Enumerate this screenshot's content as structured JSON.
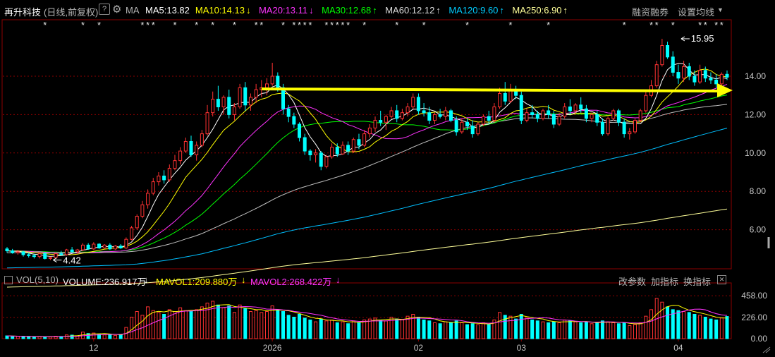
{
  "header": {
    "stock_name": "再升科技",
    "period_label": "(日线,前复权)",
    "help_icon": "question-icon",
    "settings_icon": "gear-icon",
    "ma_label": "MA",
    "ma_items": [
      {
        "text": "MA5:13.82",
        "arrow": "",
        "color": "#ffffff"
      },
      {
        "text": "MA10:14.13",
        "arrow": "↓",
        "color": "#ffff00"
      },
      {
        "text": "MA20:13.11",
        "arrow": "↓",
        "color": "#ff33ff"
      },
      {
        "text": "MA30:12.68",
        "arrow": "↑",
        "color": "#00ff00"
      },
      {
        "text": "MA60:12.12",
        "arrow": "↑",
        "color": "#dcdcdc"
      },
      {
        "text": "MA120:9.60",
        "arrow": "↑",
        "color": "#00ccff"
      },
      {
        "text": "MA250:6.90",
        "arrow": "↑",
        "color": "#ffff99"
      }
    ],
    "margin_btn": "融资融券",
    "ma_setting_btn": "设置均线"
  },
  "volume_header": {
    "label": "VOL(5,10)",
    "volume": "VOLUME:236.917万",
    "volume_arrow": "↓",
    "mavol1": "MAVOL1:209.880万",
    "mavol1_arrow": "↓",
    "mavol2": "MAVOL2:268.422万",
    "mavol2_arrow": "↓",
    "btn_params": "改参数",
    "btn_add": "加指标",
    "btn_switch": "换指标"
  },
  "colors": {
    "up": "#ff3232",
    "down": "#00ffff",
    "ma5": "#ffffff",
    "ma10": "#ffff00",
    "ma20": "#ff33ff",
    "ma30": "#00ff00",
    "ma60": "#c0c0c0",
    "ma120": "#00bfff",
    "ma250": "#ffff99",
    "trend_arrow": "#ffff00",
    "grid": "#8b0000",
    "axis_text": "#c8c8c8"
  },
  "chart_data": {
    "type": "candlestick",
    "price_axis": {
      "ticks": [
        "14.00",
        "12.00",
        "10.00",
        "8.00",
        "6.00"
      ],
      "values": [
        14,
        12,
        10,
        8,
        6
      ],
      "ylim": [
        4.0,
        16.5
      ]
    },
    "volume_axis": {
      "ticks": [
        "458.00",
        "226.00",
        "0.00"
      ],
      "values": [
        458,
        226,
        0
      ],
      "ylim": [
        0,
        520
      ]
    },
    "x_ticks": [
      {
        "label": "12",
        "index": 16
      },
      {
        "label": "2026",
        "index": 49
      },
      {
        "label": "02",
        "index": 76
      },
      {
        "label": "03",
        "index": 95
      },
      {
        "label": "04",
        "index": 124
      }
    ],
    "annotations": {
      "high": {
        "label": "15.95",
        "value": 15.95,
        "index": 124
      },
      "low": {
        "label": "4.42",
        "value": 4.42,
        "index": 8
      }
    },
    "trend_line": {
      "value": 13.3,
      "from_index": 47,
      "to_index": 137
    },
    "star_marker": "*",
    "star_indices": [
      7,
      14,
      17,
      25,
      26,
      27,
      31,
      35,
      38,
      42,
      46,
      47,
      51,
      53,
      54,
      55,
      56,
      59,
      60,
      61,
      62,
      63,
      66,
      72,
      77,
      85,
      93,
      100,
      114,
      119,
      120,
      123,
      128,
      129,
      131,
      132
    ],
    "candles": [
      {
        "o": 5.0,
        "h": 5.1,
        "l": 4.8,
        "c": 4.9,
        "v": 30
      },
      {
        "o": 4.9,
        "h": 5.0,
        "l": 4.75,
        "c": 4.8,
        "v": 26
      },
      {
        "o": 4.8,
        "h": 4.95,
        "l": 4.7,
        "c": 4.85,
        "v": 24
      },
      {
        "o": 4.85,
        "h": 4.9,
        "l": 4.6,
        "c": 4.7,
        "v": 22
      },
      {
        "o": 4.7,
        "h": 4.8,
        "l": 4.55,
        "c": 4.65,
        "v": 20
      },
      {
        "o": 4.65,
        "h": 4.75,
        "l": 4.5,
        "c": 4.6,
        "v": 18
      },
      {
        "o": 4.6,
        "h": 4.8,
        "l": 4.5,
        "c": 4.75,
        "v": 22
      },
      {
        "o": 4.75,
        "h": 4.85,
        "l": 4.45,
        "c": 4.5,
        "v": 20
      },
      {
        "o": 4.5,
        "h": 4.6,
        "l": 4.42,
        "c": 4.55,
        "v": 18
      },
      {
        "o": 4.55,
        "h": 4.8,
        "l": 4.5,
        "c": 4.75,
        "v": 26
      },
      {
        "o": 4.75,
        "h": 4.9,
        "l": 4.65,
        "c": 4.7,
        "v": 24
      },
      {
        "o": 4.7,
        "h": 5.0,
        "l": 4.65,
        "c": 4.95,
        "v": 40
      },
      {
        "o": 4.95,
        "h": 5.1,
        "l": 4.8,
        "c": 4.85,
        "v": 38
      },
      {
        "o": 4.85,
        "h": 5.0,
        "l": 4.75,
        "c": 4.95,
        "v": 30
      },
      {
        "o": 4.95,
        "h": 5.3,
        "l": 4.9,
        "c": 5.2,
        "v": 70
      },
      {
        "o": 5.2,
        "h": 5.3,
        "l": 4.95,
        "c": 5.0,
        "v": 55
      },
      {
        "o": 5.0,
        "h": 5.35,
        "l": 4.95,
        "c": 5.25,
        "v": 60
      },
      {
        "o": 5.25,
        "h": 5.3,
        "l": 5.0,
        "c": 5.05,
        "v": 45
      },
      {
        "o": 5.05,
        "h": 5.25,
        "l": 5.0,
        "c": 5.2,
        "v": 40
      },
      {
        "o": 5.2,
        "h": 5.3,
        "l": 4.95,
        "c": 5.0,
        "v": 48
      },
      {
        "o": 5.0,
        "h": 5.2,
        "l": 4.95,
        "c": 5.15,
        "v": 35
      },
      {
        "o": 5.15,
        "h": 5.25,
        "l": 5.0,
        "c": 5.05,
        "v": 40
      },
      {
        "o": 5.05,
        "h": 5.6,
        "l": 5.0,
        "c": 5.5,
        "v": 120
      },
      {
        "o": 5.5,
        "h": 6.2,
        "l": 5.45,
        "c": 6.1,
        "v": 230
      },
      {
        "o": 6.1,
        "h": 6.8,
        "l": 6.0,
        "c": 6.7,
        "v": 290
      },
      {
        "o": 6.7,
        "h": 7.5,
        "l": 6.6,
        "c": 7.3,
        "v": 250
      },
      {
        "o": 7.3,
        "h": 8.1,
        "l": 7.1,
        "c": 7.9,
        "v": 340
      },
      {
        "o": 7.9,
        "h": 8.7,
        "l": 7.8,
        "c": 8.5,
        "v": 300
      },
      {
        "o": 8.5,
        "h": 9.0,
        "l": 8.3,
        "c": 8.8,
        "v": 280
      },
      {
        "o": 8.8,
        "h": 9.1,
        "l": 8.4,
        "c": 8.6,
        "v": 260
      },
      {
        "o": 8.6,
        "h": 9.4,
        "l": 8.5,
        "c": 9.2,
        "v": 310
      },
      {
        "o": 9.2,
        "h": 9.9,
        "l": 9.1,
        "c": 9.6,
        "v": 290
      },
      {
        "o": 9.6,
        "h": 10.3,
        "l": 9.4,
        "c": 10.1,
        "v": 330
      },
      {
        "o": 10.1,
        "h": 10.8,
        "l": 10.0,
        "c": 10.6,
        "v": 300
      },
      {
        "o": 10.6,
        "h": 10.9,
        "l": 9.8,
        "c": 9.9,
        "v": 290
      },
      {
        "o": 9.9,
        "h": 10.6,
        "l": 9.6,
        "c": 10.4,
        "v": 310
      },
      {
        "o": 10.4,
        "h": 11.2,
        "l": 10.3,
        "c": 11.0,
        "v": 340
      },
      {
        "o": 11.0,
        "h": 12.5,
        "l": 10.9,
        "c": 12.1,
        "v": 380
      },
      {
        "o": 12.1,
        "h": 13.2,
        "l": 11.9,
        "c": 12.8,
        "v": 400
      },
      {
        "o": 12.8,
        "h": 13.5,
        "l": 12.2,
        "c": 12.4,
        "v": 360
      },
      {
        "o": 12.4,
        "h": 13.0,
        "l": 12.0,
        "c": 12.9,
        "v": 330
      },
      {
        "o": 12.9,
        "h": 13.3,
        "l": 11.8,
        "c": 12.0,
        "v": 350
      },
      {
        "o": 12.0,
        "h": 12.6,
        "l": 11.7,
        "c": 12.4,
        "v": 280
      },
      {
        "o": 12.4,
        "h": 13.6,
        "l": 12.3,
        "c": 13.4,
        "v": 360
      },
      {
        "o": 13.4,
        "h": 13.7,
        "l": 12.2,
        "c": 12.5,
        "v": 320
      },
      {
        "o": 12.5,
        "h": 13.1,
        "l": 12.2,
        "c": 12.9,
        "v": 290
      },
      {
        "o": 12.9,
        "h": 13.6,
        "l": 12.6,
        "c": 13.3,
        "v": 300
      },
      {
        "o": 13.3,
        "h": 13.8,
        "l": 12.9,
        "c": 13.4,
        "v": 280
      },
      {
        "o": 13.4,
        "h": 13.9,
        "l": 13.0,
        "c": 13.6,
        "v": 290
      },
      {
        "o": 13.6,
        "h": 14.7,
        "l": 13.5,
        "c": 14.0,
        "v": 350
      },
      {
        "o": 14.0,
        "h": 14.2,
        "l": 13.2,
        "c": 13.4,
        "v": 310
      },
      {
        "o": 13.4,
        "h": 13.6,
        "l": 12.0,
        "c": 12.3,
        "v": 290
      },
      {
        "o": 12.3,
        "h": 12.5,
        "l": 11.6,
        "c": 11.9,
        "v": 250
      },
      {
        "o": 11.9,
        "h": 12.1,
        "l": 11.3,
        "c": 11.5,
        "v": 230
      },
      {
        "o": 11.5,
        "h": 11.6,
        "l": 10.6,
        "c": 10.8,
        "v": 260
      },
      {
        "o": 10.8,
        "h": 11.0,
        "l": 9.9,
        "c": 10.1,
        "v": 220
      },
      {
        "o": 10.1,
        "h": 10.2,
        "l": 9.6,
        "c": 9.9,
        "v": 200
      },
      {
        "o": 9.9,
        "h": 10.2,
        "l": 9.5,
        "c": 10.0,
        "v": 180
      },
      {
        "o": 10.0,
        "h": 10.1,
        "l": 9.1,
        "c": 9.3,
        "v": 210
      },
      {
        "o": 9.3,
        "h": 9.9,
        "l": 9.2,
        "c": 9.8,
        "v": 190
      },
      {
        "o": 9.8,
        "h": 10.5,
        "l": 9.7,
        "c": 10.3,
        "v": 200
      },
      {
        "o": 10.3,
        "h": 10.5,
        "l": 9.8,
        "c": 9.95,
        "v": 170
      },
      {
        "o": 9.95,
        "h": 10.6,
        "l": 9.9,
        "c": 10.4,
        "v": 180
      },
      {
        "o": 10.4,
        "h": 10.6,
        "l": 9.9,
        "c": 10.1,
        "v": 160
      },
      {
        "o": 10.1,
        "h": 10.8,
        "l": 10.0,
        "c": 10.7,
        "v": 190
      },
      {
        "o": 10.7,
        "h": 11.0,
        "l": 10.2,
        "c": 10.4,
        "v": 170
      },
      {
        "o": 10.4,
        "h": 11.2,
        "l": 10.3,
        "c": 11.0,
        "v": 200
      },
      {
        "o": 11.0,
        "h": 11.5,
        "l": 10.8,
        "c": 11.3,
        "v": 210
      },
      {
        "o": 11.3,
        "h": 11.9,
        "l": 11.1,
        "c": 11.7,
        "v": 220
      },
      {
        "o": 11.7,
        "h": 12.2,
        "l": 11.4,
        "c": 11.6,
        "v": 200
      },
      {
        "o": 11.6,
        "h": 12.0,
        "l": 11.2,
        "c": 11.9,
        "v": 190
      },
      {
        "o": 11.9,
        "h": 12.4,
        "l": 11.8,
        "c": 12.2,
        "v": 230
      },
      {
        "o": 12.2,
        "h": 12.5,
        "l": 11.6,
        "c": 11.8,
        "v": 210
      },
      {
        "o": 11.8,
        "h": 12.3,
        "l": 11.7,
        "c": 12.1,
        "v": 200
      },
      {
        "o": 12.1,
        "h": 12.6,
        "l": 11.9,
        "c": 12.4,
        "v": 240
      },
      {
        "o": 12.4,
        "h": 13.1,
        "l": 12.3,
        "c": 12.9,
        "v": 260
      },
      {
        "o": 12.9,
        "h": 13.1,
        "l": 12.0,
        "c": 12.2,
        "v": 230
      },
      {
        "o": 12.2,
        "h": 12.6,
        "l": 11.9,
        "c": 12.1,
        "v": 200
      },
      {
        "o": 12.1,
        "h": 12.4,
        "l": 11.5,
        "c": 11.7,
        "v": 190
      },
      {
        "o": 11.7,
        "h": 12.1,
        "l": 11.5,
        "c": 12.0,
        "v": 170
      },
      {
        "o": 12.0,
        "h": 12.3,
        "l": 11.8,
        "c": 11.9,
        "v": 160
      },
      {
        "o": 11.9,
        "h": 12.4,
        "l": 11.7,
        "c": 12.2,
        "v": 180
      },
      {
        "o": 12.2,
        "h": 12.3,
        "l": 11.6,
        "c": 11.7,
        "v": 170
      },
      {
        "o": 11.7,
        "h": 11.9,
        "l": 10.9,
        "c": 11.1,
        "v": 190
      },
      {
        "o": 11.1,
        "h": 11.8,
        "l": 11.0,
        "c": 11.6,
        "v": 170
      },
      {
        "o": 11.6,
        "h": 11.8,
        "l": 11.2,
        "c": 11.4,
        "v": 150
      },
      {
        "o": 11.4,
        "h": 11.7,
        "l": 10.8,
        "c": 11.0,
        "v": 160
      },
      {
        "o": 11.0,
        "h": 11.6,
        "l": 10.9,
        "c": 11.5,
        "v": 150
      },
      {
        "o": 11.5,
        "h": 12.0,
        "l": 11.4,
        "c": 11.9,
        "v": 170
      },
      {
        "o": 11.9,
        "h": 12.2,
        "l": 11.5,
        "c": 11.7,
        "v": 150
      },
      {
        "o": 11.7,
        "h": 12.6,
        "l": 11.6,
        "c": 12.4,
        "v": 200
      },
      {
        "o": 12.4,
        "h": 13.4,
        "l": 12.3,
        "c": 13.1,
        "v": 280
      },
      {
        "o": 13.1,
        "h": 13.7,
        "l": 12.5,
        "c": 12.7,
        "v": 250
      },
      {
        "o": 12.7,
        "h": 13.6,
        "l": 12.6,
        "c": 13.3,
        "v": 240
      },
      {
        "o": 13.3,
        "h": 13.5,
        "l": 12.8,
        "c": 13.0,
        "v": 210
      },
      {
        "o": 13.0,
        "h": 13.2,
        "l": 11.5,
        "c": 11.7,
        "v": 260
      },
      {
        "o": 11.7,
        "h": 12.3,
        "l": 11.6,
        "c": 12.1,
        "v": 220
      },
      {
        "o": 12.1,
        "h": 12.5,
        "l": 11.8,
        "c": 12.0,
        "v": 200
      },
      {
        "o": 12.0,
        "h": 12.2,
        "l": 11.6,
        "c": 11.8,
        "v": 190
      },
      {
        "o": 11.8,
        "h": 12.3,
        "l": 11.7,
        "c": 12.2,
        "v": 180
      },
      {
        "o": 12.2,
        "h": 12.5,
        "l": 11.8,
        "c": 12.0,
        "v": 170
      },
      {
        "o": 12.0,
        "h": 12.2,
        "l": 11.3,
        "c": 11.5,
        "v": 180
      },
      {
        "o": 11.5,
        "h": 12.1,
        "l": 11.4,
        "c": 11.9,
        "v": 170
      },
      {
        "o": 11.9,
        "h": 12.6,
        "l": 11.8,
        "c": 12.4,
        "v": 200
      },
      {
        "o": 12.4,
        "h": 12.8,
        "l": 12.0,
        "c": 12.2,
        "v": 190
      },
      {
        "o": 12.2,
        "h": 12.6,
        "l": 12.0,
        "c": 12.5,
        "v": 180
      },
      {
        "o": 12.5,
        "h": 12.9,
        "l": 12.1,
        "c": 12.3,
        "v": 170
      },
      {
        "o": 12.3,
        "h": 12.5,
        "l": 11.6,
        "c": 11.8,
        "v": 180
      },
      {
        "o": 11.8,
        "h": 12.1,
        "l": 11.6,
        "c": 12.0,
        "v": 160
      },
      {
        "o": 12.0,
        "h": 12.2,
        "l": 11.4,
        "c": 11.6,
        "v": 170
      },
      {
        "o": 11.6,
        "h": 11.8,
        "l": 10.9,
        "c": 11.0,
        "v": 190
      },
      {
        "o": 11.0,
        "h": 11.9,
        "l": 10.9,
        "c": 11.8,
        "v": 180
      },
      {
        "o": 11.8,
        "h": 12.3,
        "l": 11.7,
        "c": 12.2,
        "v": 170
      },
      {
        "o": 12.2,
        "h": 12.3,
        "l": 11.4,
        "c": 11.6,
        "v": 160
      },
      {
        "o": 11.6,
        "h": 11.8,
        "l": 10.8,
        "c": 11.0,
        "v": 170
      },
      {
        "o": 11.0,
        "h": 11.3,
        "l": 10.7,
        "c": 11.1,
        "v": 140
      },
      {
        "o": 11.1,
        "h": 11.8,
        "l": 11.0,
        "c": 11.7,
        "v": 150
      },
      {
        "o": 11.7,
        "h": 12.3,
        "l": 11.6,
        "c": 12.2,
        "v": 170
      },
      {
        "o": 12.2,
        "h": 13.2,
        "l": 12.1,
        "c": 13.0,
        "v": 240
      },
      {
        "o": 13.0,
        "h": 13.8,
        "l": 12.9,
        "c": 13.5,
        "v": 310
      },
      {
        "o": 13.5,
        "h": 14.8,
        "l": 13.4,
        "c": 14.6,
        "v": 430
      },
      {
        "o": 14.6,
        "h": 15.95,
        "l": 14.5,
        "c": 15.6,
        "v": 390
      },
      {
        "o": 15.6,
        "h": 15.8,
        "l": 14.9,
        "c": 15.0,
        "v": 340
      },
      {
        "o": 15.0,
        "h": 15.3,
        "l": 14.0,
        "c": 14.2,
        "v": 310
      },
      {
        "o": 14.2,
        "h": 14.6,
        "l": 13.6,
        "c": 13.9,
        "v": 300
      },
      {
        "o": 13.9,
        "h": 14.8,
        "l": 13.7,
        "c": 14.5,
        "v": 290
      },
      {
        "o": 14.5,
        "h": 14.7,
        "l": 13.8,
        "c": 14.0,
        "v": 280
      },
      {
        "o": 14.0,
        "h": 14.3,
        "l": 13.5,
        "c": 13.7,
        "v": 260
      },
      {
        "o": 13.7,
        "h": 14.6,
        "l": 13.6,
        "c": 14.3,
        "v": 250
      },
      {
        "o": 14.3,
        "h": 14.5,
        "l": 13.7,
        "c": 13.9,
        "v": 230
      },
      {
        "o": 13.9,
        "h": 14.2,
        "l": 13.6,
        "c": 13.8,
        "v": 210
      },
      {
        "o": 13.8,
        "h": 14.1,
        "l": 13.4,
        "c": 13.6,
        "v": 200
      },
      {
        "o": 13.6,
        "h": 14.2,
        "l": 13.5,
        "c": 14.1,
        "v": 220
      },
      {
        "o": 14.1,
        "h": 14.3,
        "l": 13.8,
        "c": 13.95,
        "v": 237
      }
    ]
  }
}
